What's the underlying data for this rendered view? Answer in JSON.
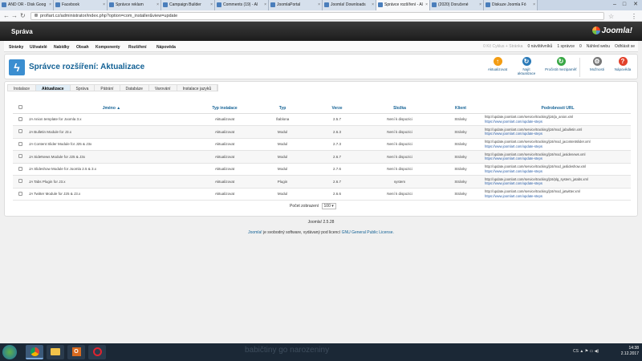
{
  "browser": {
    "tabs": [
      {
        "label": "AND OR - Disk Goog",
        "active": false
      },
      {
        "label": "Facebook",
        "active": false
      },
      {
        "label": "Správce reklam",
        "active": false
      },
      {
        "label": "Campaign Builder",
        "active": false
      },
      {
        "label": "Comments (19) - Al",
        "active": false
      },
      {
        "label": "JoomlaPortal",
        "active": false
      },
      {
        "label": "Joomla! Downloads",
        "active": false
      },
      {
        "label": "Správce rozšíření - Al",
        "active": true
      },
      {
        "label": "(2020) Doručené",
        "active": false
      },
      {
        "label": "Diskuze Joomla Fó",
        "active": false
      }
    ],
    "url": "profiart.cz/administrator/index.php?option=com_installer&view=update"
  },
  "header": {
    "title": "Správa",
    "logo": "Joomla!"
  },
  "menu": {
    "items": [
      "Stránky",
      "Uživatelé",
      "Nabídky",
      "Obsah",
      "Komponenty",
      "Rozšíření",
      "Nápověda"
    ],
    "status": {
      "hidden": "0 Kč Cyklus + Stránka",
      "users": "0 návštěvníků",
      "admins": "1 správce",
      "messages": "0",
      "view_site": "Náhled webu",
      "logout": "Odhlásit se"
    }
  },
  "toolbar": {
    "page_title": "Správce rozšíření: Aktualizace",
    "buttons": [
      {
        "label": "Aktualizovat",
        "color": "#f39c12",
        "glyph": "↑"
      },
      {
        "label": "Najít aktualizace",
        "color": "#2a7ab8",
        "glyph": "↻"
      },
      {
        "label": "Pročistit mezipaměť",
        "color": "#39a845",
        "glyph": "↻"
      },
      {
        "label": "Možnosti",
        "color": "#777777",
        "glyph": "⚙"
      },
      {
        "label": "Nápověda",
        "color": "#e2412b",
        "glyph": "?"
      }
    ]
  },
  "subtabs": [
    "Instalace",
    "Aktualizace",
    "Správa",
    "Pátrání",
    "Databáze",
    "Varování",
    "Instalace jazyků"
  ],
  "subtabs_active": "Aktualizace",
  "table": {
    "headers": [
      "Jméno",
      "Typ instalace",
      "Typ",
      "Verze",
      "Složka",
      "Klient",
      "Podrobnosti URL"
    ],
    "rows": [
      {
        "name": "JA Anion template for Joomla 3.x",
        "install": "Aktualizovat",
        "type": "Šablona",
        "version": "2.5.7",
        "folder": "Není k dispozici",
        "client": "Stránky",
        "url1": "http://update.joomlart.com/service/tracking/j16/ja_anion.xml",
        "url2": "https://www.joomlart.com/update-steps"
      },
      {
        "name": "JA Bulletin Module for J3.x",
        "install": "Aktualizovat",
        "type": "Modul",
        "version": "2.6.3",
        "folder": "Není k dispozici",
        "client": "Stránky",
        "url1": "http://update.joomlart.com/service/tracking/j16/mod_jabulletin.xml",
        "url2": "https://www.joomlart.com/update-steps"
      },
      {
        "name": "JA Content Slider Module for J25 & J3x",
        "install": "Aktualizovat",
        "type": "Modul",
        "version": "2.7.3",
        "folder": "Není k dispozici",
        "client": "Stránky",
        "url1": "http://update.joomlart.com/service/tracking/j16/mod_jacontentslider.xml",
        "url2": "https://www.joomlart.com/update-steps"
      },
      {
        "name": "JA SideNews Module for J25 & J3x",
        "install": "Aktualizovat",
        "type": "Modul",
        "version": "2.6.7",
        "folder": "Není k dispozici",
        "client": "Stránky",
        "url1": "http://update.joomlart.com/service/tracking/j16/mod_jasidenews.xml",
        "url2": "https://www.joomlart.com/update-steps"
      },
      {
        "name": "JA Slideshow Module for Joomla 2.5 & 3.x",
        "install": "Aktualizovat",
        "type": "Modul",
        "version": "2.7.6",
        "folder": "Není k dispozici",
        "client": "Stránky",
        "url1": "http://update.joomlart.com/service/tracking/j16/mod_jaslideshow.xml",
        "url2": "https://www.joomlart.com/update-steps"
      },
      {
        "name": "JA Tabs Plugin for J3.x",
        "install": "Aktualizovat",
        "type": "Plugin",
        "version": "2.6.7",
        "folder": "system",
        "client": "Stránky",
        "url1": "http://update.joomlart.com/service/tracking/j16/plg_system_jatabs.xml",
        "url2": "https://www.joomlart.com/update-steps"
      },
      {
        "name": "JA Twitter Module for J25 & J3.x",
        "install": "Aktualizovat",
        "type": "Modul",
        "version": "2.6.6",
        "folder": "Není k dispozici",
        "client": "Stránky",
        "url1": "http://update.joomlart.com/service/tracking/j16/mod_jatwitter.xml",
        "url2": "https://www.joomlart.com/update-steps"
      }
    ]
  },
  "pager": {
    "label": "Počet zobrazení",
    "value": "100"
  },
  "footer": {
    "version": "Joomla! 2.5.28",
    "license_pre": "Joomla!",
    "license_mid": "je svobodný software, vydávaný pod licencí",
    "license_link": "GNU General Public License."
  },
  "taskbar": {
    "overlay": "babičtiny go narozeniny",
    "lang": "CS",
    "time": "14:38",
    "date": "2.12.2017"
  }
}
